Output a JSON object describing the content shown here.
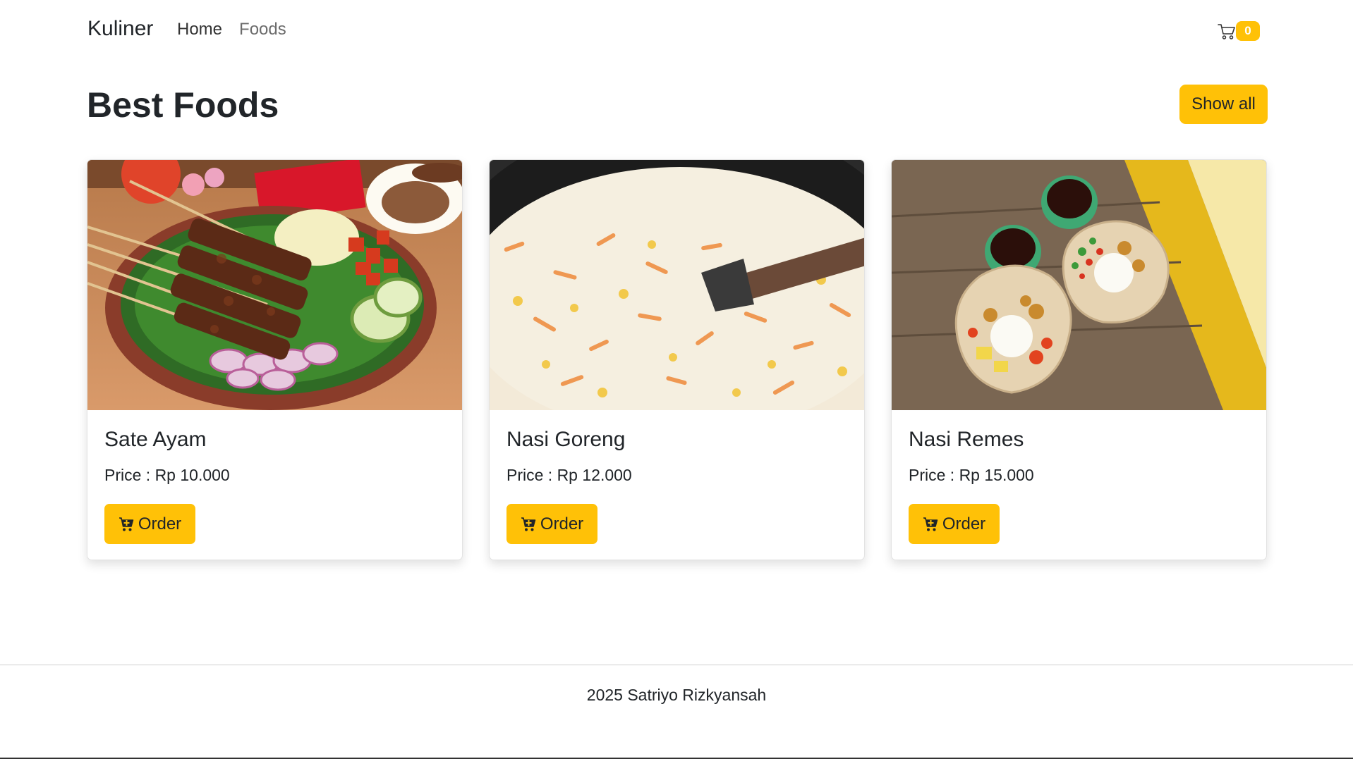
{
  "navbar": {
    "brand": "Kuliner",
    "links": [
      {
        "label": "Home"
      },
      {
        "label": "Foods"
      }
    ],
    "cart": {
      "icon": "cart-icon",
      "count": "0"
    }
  },
  "section": {
    "title_bold": "Best",
    "title_rest": "Foods",
    "show_all_label": "Show all"
  },
  "foods": [
    {
      "name": "Sate Ayam",
      "price": "Price : Rp 10.000",
      "order_label": "Order",
      "image": "sate-ayam-photo"
    },
    {
      "name": "Nasi Goreng",
      "price": "Price : Rp 12.000",
      "order_label": "Order",
      "image": "nasi-goreng-photo"
    },
    {
      "name": "Nasi Remes",
      "price": "Price : Rp 15.000",
      "order_label": "Order",
      "image": "nasi-remes-photo"
    }
  ],
  "footer": {
    "text": "2025 Satriyo Rizkyansah"
  },
  "colors": {
    "accent": "#ffc107",
    "text": "#212529"
  }
}
